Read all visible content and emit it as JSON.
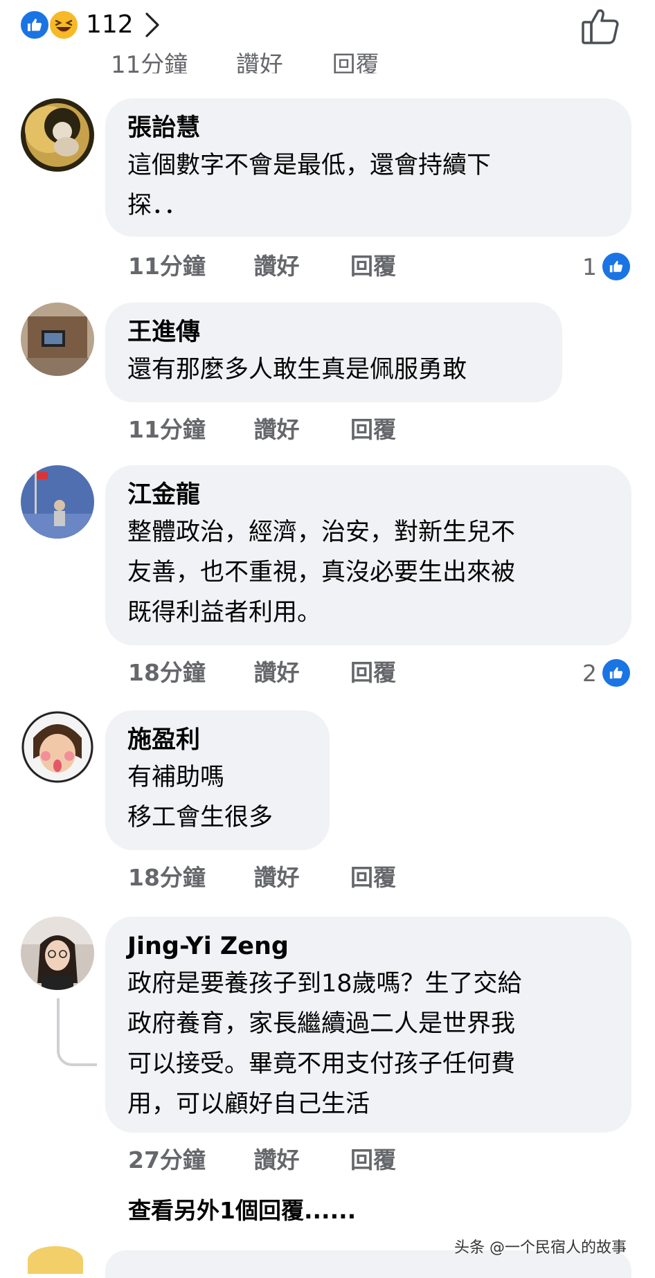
{
  "reactions": {
    "count": "112",
    "icons": [
      "like-reaction-icon",
      "haha-reaction-icon",
      "chevron-right-icon"
    ],
    "like_icon": "thumbs-up-outline-icon"
  },
  "accent_color": "#1b74e4",
  "bubble_color": "#f0f2f5",
  "meta_color": "#65676b",
  "cut_off_meta": {
    "time": "11分鐘",
    "like": "讚好",
    "reply": "回覆"
  },
  "comments": [
    {
      "name": "張詒慧",
      "lines": [
        "這個數字不會是最低，還會持續下",
        "探．．"
      ],
      "time": "11分鐘",
      "like": "讚好",
      "reply": "回覆",
      "likes": "1"
    },
    {
      "name": "王進傳",
      "lines": [
        "還有那麼多人敢生真是佩服勇敢"
      ],
      "time": "11分鐘",
      "like": "讚好",
      "reply": "回覆",
      "likes": ""
    },
    {
      "name": "江金龍",
      "lines": [
        "整體政治，經濟，治安，對新生兒不",
        "友善，也不重視，真沒必要生出來被",
        "既得利益者利用。"
      ],
      "time": "18分鐘",
      "like": "讚好",
      "reply": "回覆",
      "likes": "2"
    },
    {
      "name": "施盈利",
      "lines": [
        "有補助嗎",
        "移工會生很多"
      ],
      "time": "18分鐘",
      "like": "讚好",
      "reply": "回覆",
      "likes": ""
    },
    {
      "name": "Jing-Yi Zeng",
      "lines": [
        "政府是要養孩子到18歲嗎？生了交給",
        "政府養育，家長繼續過二人是世界我",
        "可以接受。畢竟不用支付孩子任何費",
        "用，可以顧好自己生活"
      ],
      "time": "27分鐘",
      "like": "讚好",
      "reply": "回覆",
      "likes": ""
    }
  ],
  "view_more_replies": "查看另外1個回覆......",
  "watermark": "头条 @一个民宿人的故事"
}
